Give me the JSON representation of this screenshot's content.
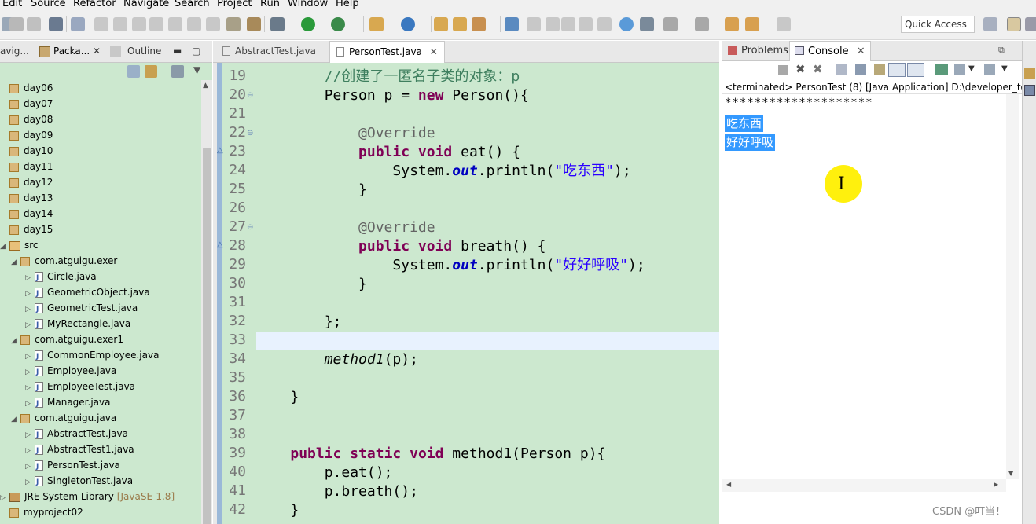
{
  "menubar": {
    "items": [
      "Edit",
      "Source",
      "Refactor",
      "Navigate",
      "Search",
      "Project",
      "Run",
      "Window",
      "Help"
    ]
  },
  "toolbar": {
    "quick_access": "Quick Access"
  },
  "left_panel": {
    "tabs": [
      "avig...",
      "Packa...",
      "Outline"
    ],
    "tree": [
      {
        "label": "day06",
        "indent": 0,
        "icon": "folder-icon"
      },
      {
        "label": "day07",
        "indent": 0,
        "icon": "folder-icon"
      },
      {
        "label": "day08",
        "indent": 0,
        "icon": "folder-icon"
      },
      {
        "label": "day09",
        "indent": 0,
        "icon": "folder-icon"
      },
      {
        "label": "day10",
        "indent": 0,
        "icon": "folder-icon"
      },
      {
        "label": "day11",
        "indent": 0,
        "icon": "folder-icon"
      },
      {
        "label": "day12",
        "indent": 0,
        "icon": "folder-icon"
      },
      {
        "label": "day13",
        "indent": 0,
        "icon": "folder-icon"
      },
      {
        "label": "day14",
        "indent": 0,
        "icon": "folder-icon"
      },
      {
        "label": "day15",
        "indent": 0,
        "icon": "folder-icon"
      },
      {
        "label": "src",
        "indent": 0,
        "icon": "source-folder-icon",
        "expanded": true
      },
      {
        "label": "com.atguigu.exer",
        "indent": 1,
        "icon": "package-icon",
        "expanded": true
      },
      {
        "label": "Circle.java",
        "indent": 2,
        "icon": "java-file-icon"
      },
      {
        "label": "GeometricObject.java",
        "indent": 2,
        "icon": "java-file-icon"
      },
      {
        "label": "GeometricTest.java",
        "indent": 2,
        "icon": "java-file-icon"
      },
      {
        "label": "MyRectangle.java",
        "indent": 2,
        "icon": "java-file-icon"
      },
      {
        "label": "com.atguigu.exer1",
        "indent": 1,
        "icon": "package-icon",
        "expanded": true
      },
      {
        "label": "CommonEmployee.java",
        "indent": 2,
        "icon": "java-file-icon"
      },
      {
        "label": "Employee.java",
        "indent": 2,
        "icon": "java-file-icon"
      },
      {
        "label": "EmployeeTest.java",
        "indent": 2,
        "icon": "java-file-icon"
      },
      {
        "label": "Manager.java",
        "indent": 2,
        "icon": "java-file-icon"
      },
      {
        "label": "com.atguigu.java",
        "indent": 1,
        "icon": "package-icon",
        "expanded": true
      },
      {
        "label": "AbstractTest.java",
        "indent": 2,
        "icon": "java-file-icon"
      },
      {
        "label": "AbstractTest1.java",
        "indent": 2,
        "icon": "java-file-icon"
      },
      {
        "label": "PersonTest.java",
        "indent": 2,
        "icon": "java-file-icon"
      },
      {
        "label": "SingletonTest.java",
        "indent": 2,
        "icon": "java-file-icon"
      },
      {
        "label": "JRE System Library",
        "suffix": "[JavaSE-1.8]",
        "indent": 0,
        "icon": "library-icon"
      },
      {
        "label": "myproject02",
        "indent": 0,
        "icon": "project-icon"
      }
    ]
  },
  "editor": {
    "tabs": [
      {
        "label": "AbstractTest.java",
        "active": false
      },
      {
        "label": "PersonTest.java",
        "active": true
      }
    ],
    "line_numbers": [
      "19",
      "20",
      "21",
      "22",
      "23",
      "24",
      "25",
      "26",
      "27",
      "28",
      "29",
      "30",
      "31",
      "32",
      "33",
      "34",
      "35",
      "36",
      "37",
      "38",
      "39",
      "40",
      "41",
      "42"
    ],
    "current_line": 14,
    "code": {
      "c19": "//创建了一匿名子类的对象：p",
      "c20a": "Person p = ",
      "c20b": "new",
      "c20c": " Person(){",
      "c22": "@Override",
      "c23a": "public",
      "c23b": " ",
      "c23c": "void",
      "c23d": " eat() {",
      "c24a": "System.",
      "c24b": "out",
      "c24c": ".println(",
      "c24d": "\"吃东西\"",
      "c24e": ");",
      "c25": "}",
      "c27": "@Override",
      "c28a": "public",
      "c28c": "void",
      "c28d": " breath() {",
      "c29a": "System.",
      "c29b": "out",
      "c29c": ".println(",
      "c29d": "\"好好呼吸\"",
      "c29e": ");",
      "c30": "}",
      "c32": "};",
      "c34a": "method1",
      "c34b": "(p);",
      "c36": "}",
      "c39a": "public",
      "c39b": "static",
      "c39c": "void",
      "c39d": " method1(Person p){",
      "c40": "p.eat();",
      "c41": "p.breath();",
      "c42": "}"
    }
  },
  "right_panel": {
    "tabs": [
      {
        "label": "Problems",
        "active": false
      },
      {
        "label": "Console",
        "active": true
      }
    ],
    "status": "<terminated> PersonTest (8) [Java Application] D:\\developer_to",
    "output": [
      "********************",
      "吃东西",
      "好好呼吸"
    ]
  },
  "watermark": "CSDN @叮当！"
}
